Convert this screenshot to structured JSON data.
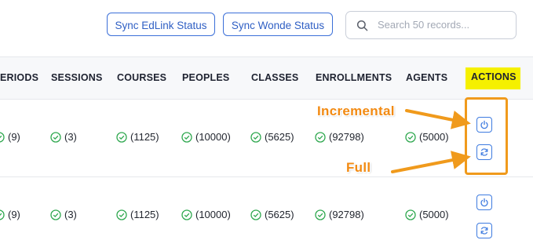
{
  "toolbar": {
    "sync_edlink_label": "Sync EdLink Status",
    "sync_wonde_label": "Sync Wonde Status"
  },
  "search": {
    "placeholder": "Search 50 records..."
  },
  "table": {
    "columns": [
      "ERIODS",
      "SESSIONS",
      "COURSES",
      "PEOPLES",
      "CLASSES",
      "ENROLLMENTS",
      "AGENTS",
      "ACTIONS"
    ],
    "rows": [
      {
        "periods": "(9)",
        "sessions": "(3)",
        "courses": "(1125)",
        "peoples": "(10000)",
        "classes": "(5625)",
        "enrollments": "(92798)",
        "agents": "(5000)"
      },
      {
        "periods": "(9)",
        "sessions": "(3)",
        "courses": "(1125)",
        "peoples": "(10000)",
        "classes": "(5625)",
        "enrollments": "(92798)",
        "agents": "(5000)"
      }
    ]
  },
  "annotations": {
    "incremental": "Incremental",
    "full": "Full"
  },
  "colors": {
    "accent": "#3b6fd8",
    "check": "#2fa84f",
    "annotation": "#f09a1c",
    "highlight": "#f5f000"
  },
  "icons": {
    "check": "check-circle-icon",
    "incremental": "power-icon",
    "full": "refresh-icon",
    "search": "search-icon"
  }
}
